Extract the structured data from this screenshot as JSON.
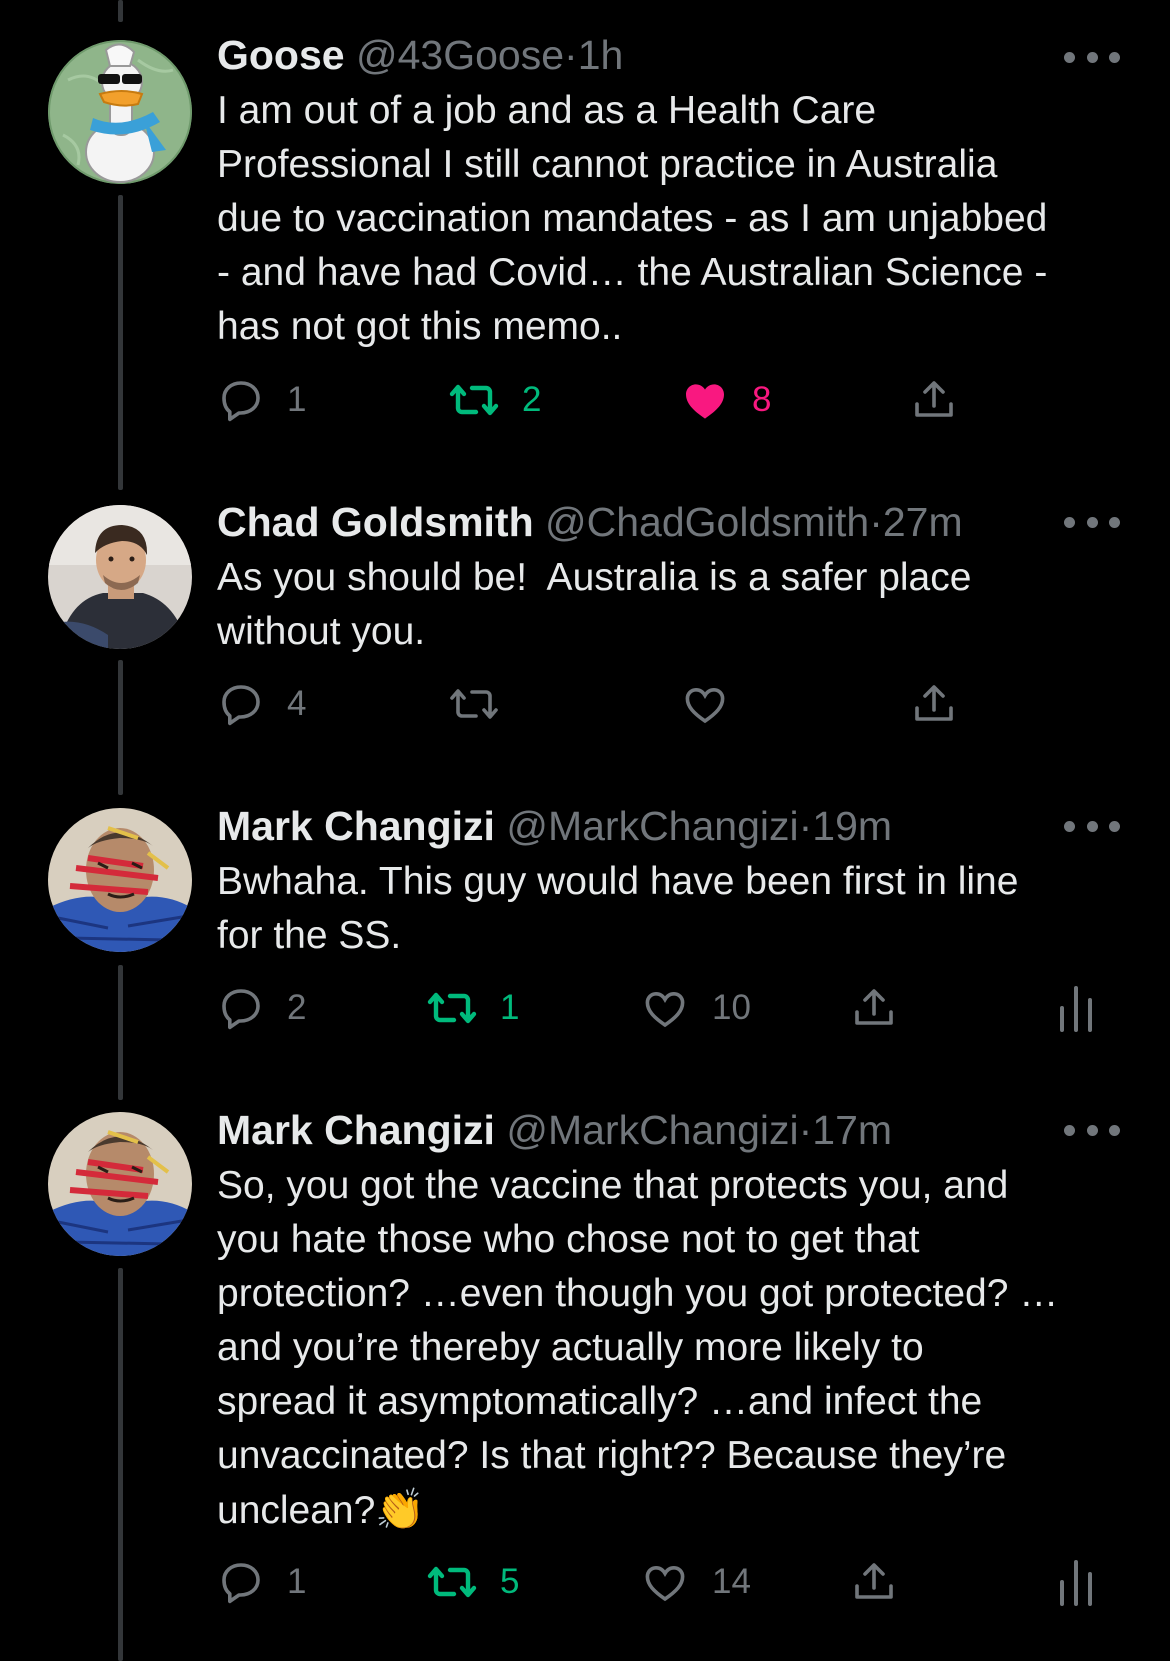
{
  "tweets": [
    {
      "name": "Goose",
      "handle": "@43Goose",
      "dot": "·",
      "time": "1h",
      "avatar": "goose-avatar",
      "text": "I am out of a job and as a Health Care\nProfessional I still cannot practice in Australia\ndue to vaccination mandates - as I am unjabbed\n- and have had Covid… the Australian Science -\nhas not got this memo..",
      "replies": "1",
      "retweets": "2",
      "likes": "8",
      "retweeted": true,
      "liked": true
    },
    {
      "name": "Chad Goldsmith",
      "handle": "@ChadGoldsmith",
      "dot": "·",
      "time": "27m",
      "avatar": "chad-avatar",
      "text": "As you should be!  Australia is a safer place\nwithout you.",
      "replies": "4",
      "retweets": "",
      "likes": "",
      "retweeted": false,
      "liked": false
    },
    {
      "name": "Mark Changizi",
      "handle": "@MarkChangizi",
      "dot": "·",
      "time": "19m",
      "avatar": "mark-avatar",
      "text": "Bwhaha. This guy would have been first in line\nfor the SS.",
      "replies": "2",
      "retweets": "1",
      "likes": "10",
      "retweeted": true,
      "liked": false,
      "analytics": true
    },
    {
      "name": "Mark Changizi",
      "handle": "@MarkChangizi",
      "dot": "·",
      "time": "17m",
      "avatar": "mark-avatar",
      "text": "So, you got the vaccine that protects you, and\nyou hate those who chose not to get that\nprotection? …even though you got protected? …\nand you’re thereby actually more likely to\nspread it asymptomatically? …and infect the\nunvaccinated? Is that right?? Because they’re\nunclean?",
      "emoji": "👏",
      "replies": "1",
      "retweets": "5",
      "likes": "14",
      "retweeted": true,
      "liked": false,
      "analytics": true
    }
  ],
  "colors": {
    "background": "#000000",
    "text": "#e7e9ea",
    "muted": "#71767b",
    "retweet_green": "#00ba7c",
    "like_pink": "#f91880",
    "thread_line": "#333639"
  },
  "icons": [
    "reply-icon",
    "retweet-icon",
    "like-icon",
    "share-icon",
    "analytics-icon",
    "more-icon"
  ]
}
